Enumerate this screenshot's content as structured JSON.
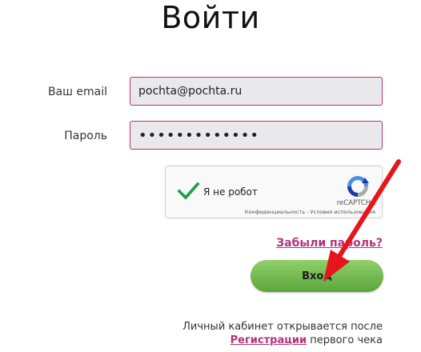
{
  "page": {
    "title": "Войти"
  },
  "form": {
    "email_label": "Ваш email",
    "email_value": "pochta@pochta.ru",
    "password_label": "Пароль",
    "password_value": "•••••••••••••"
  },
  "captcha": {
    "label": "Я не робот",
    "brand": "reCAPTCHA",
    "links": "Конфиденциальность - Условия использования",
    "checked": true
  },
  "links": {
    "forgot_password": "Забыли пароль?"
  },
  "buttons": {
    "login": "Вход"
  },
  "footer": {
    "note_line1": "Личный кабинет открывается после",
    "registration_link": "Регистрации",
    "note_line2_rest": " первого чека"
  },
  "colors": {
    "accent": "#b0347c",
    "button_green": "#6fb94a",
    "arrow_red": "#e8141c"
  }
}
